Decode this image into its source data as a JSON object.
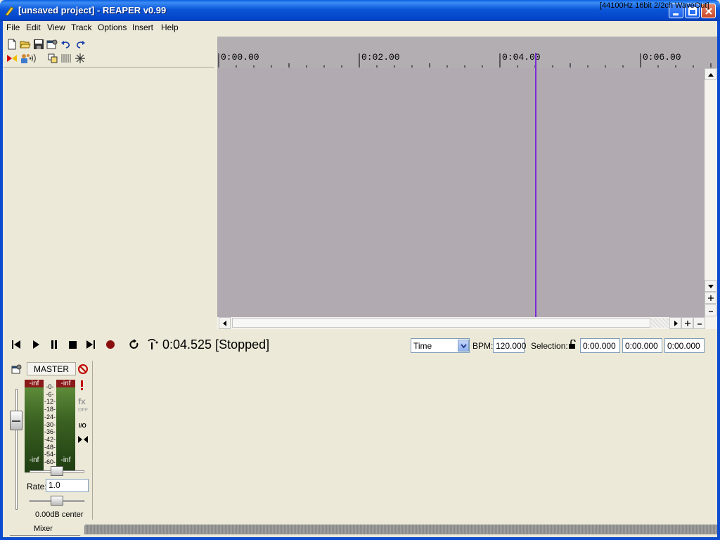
{
  "window": {
    "title": "[unsaved project] - REAPER v0.99"
  },
  "menu": {
    "items": [
      "File",
      "Edit",
      "View",
      "Track",
      "Options",
      "Insert",
      "Help"
    ],
    "audio_info": "[44100Hz 16bit 2/2ch WaveOut]"
  },
  "toolbar": {
    "icons": [
      "new-file-icon",
      "open-folder-icon",
      "save-icon",
      "project-settings-icon",
      "undo-icon",
      "redo-icon",
      "metronome-icon",
      "add-track-icon",
      "record-arm-icon",
      "routing-icon",
      "grid-icon",
      "snap-icon"
    ]
  },
  "timeline": {
    "labels": [
      "0:00.00",
      "0:02.00",
      "0:04.00",
      "0:06.00"
    ],
    "cursor_seconds": 4.525
  },
  "transport": {
    "time_display": "0:04.525 [Stopped]",
    "time_mode": "Time",
    "bpm_label": "BPM:",
    "bpm_value": "120.000",
    "selection_label": "Selection:",
    "selection_start": "0:00.000",
    "selection_end": "0:00.000",
    "selection_length": "0:00.000"
  },
  "master": {
    "name": "MASTER",
    "meter_left_peak": "-inf",
    "meter_right_peak": "-inf",
    "meter_left_bottom": "-inf",
    "meter_right_bottom": "-inf",
    "scale": [
      "-0-",
      "-6-",
      "-12-",
      "-18-",
      "-24-",
      "-30-",
      "-36-",
      "-42-",
      "-48-",
      "-54-",
      "-60-"
    ],
    "fx_label": "fx",
    "fx_state": "OFF",
    "io_label": "I/O",
    "rate_label": "Rate:",
    "rate_value": "1.0",
    "volume_pan": "0.00dB center"
  },
  "tabs": {
    "mixer": "Mixer"
  }
}
